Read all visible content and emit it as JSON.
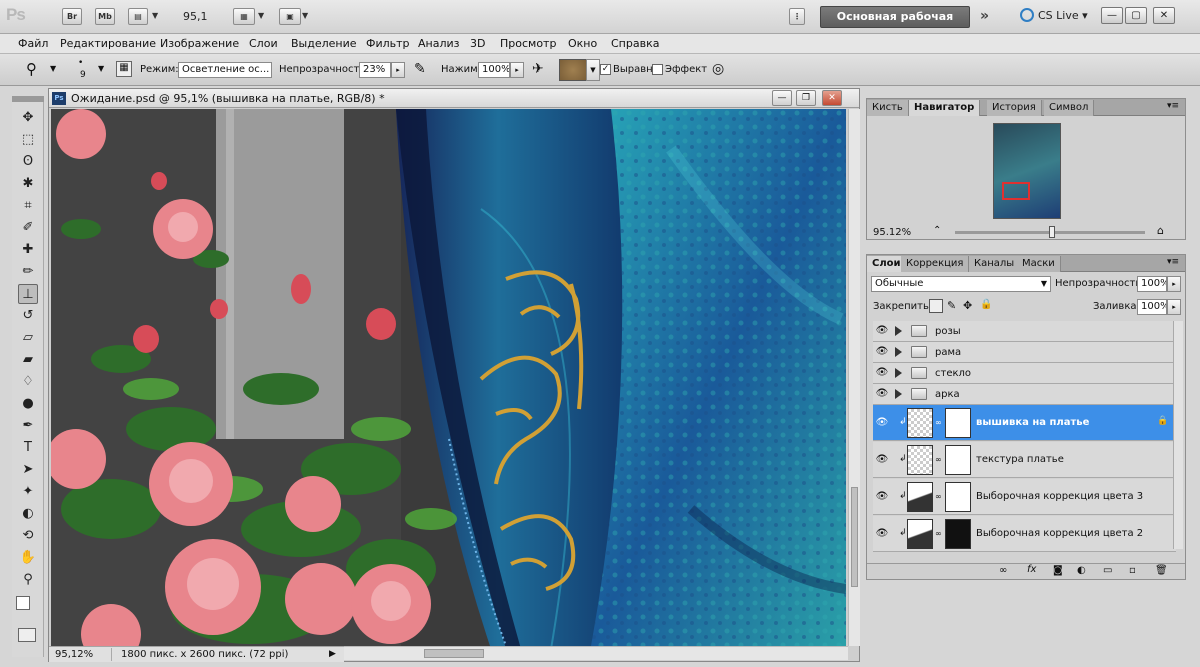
{
  "appbar": {
    "logo": "Ps",
    "br": "Br",
    "mb": "Mb",
    "zoom": "95,1",
    "workspace": "Основная рабочая среда",
    "cslive": "CS Live"
  },
  "menu": [
    "Файл",
    "Редактирование",
    "Изображение",
    "Слои",
    "Выделение",
    "Фильтр",
    "Анализ",
    "3D",
    "Просмотр",
    "Окно",
    "Справка"
  ],
  "options": {
    "brush_size": "9",
    "mode_label": "Режим:",
    "mode_value": "Осветление ос...",
    "opacity_label": "Непрозрачность:",
    "opacity_value": "23%",
    "flow_label": "Нажим:",
    "flow_value": "100%",
    "aligned_label": "Выравн.",
    "effect_label": "Эффект"
  },
  "document": {
    "title": "Ожидание.psd @ 95,1% (вышивка на платье, RGB/8) *",
    "zoom": "95,12%",
    "info": "1800 пикс. x 2600 пикс. (72 ppi)"
  },
  "navigator": {
    "tabs": [
      "Кисть",
      "Навигатор",
      "История",
      "Символ"
    ],
    "zoom": "95.12%"
  },
  "layers_panel": {
    "tabs": [
      "Слои",
      "Коррекция",
      "Каналы",
      "Маски"
    ],
    "blend_mode": "Обычные",
    "opacity_label": "Непрозрачность:",
    "opacity_value": "100%",
    "lock_label": "Закрепить:",
    "fill_label": "Заливка:",
    "fill_value": "100%",
    "groups": [
      "розы",
      "рама",
      "стекло",
      "арка"
    ],
    "layers": [
      "вышивка на платье",
      "текстура платье",
      "Выборочная коррекция цвета 3",
      "Выборочная коррекция цвета 2"
    ]
  }
}
